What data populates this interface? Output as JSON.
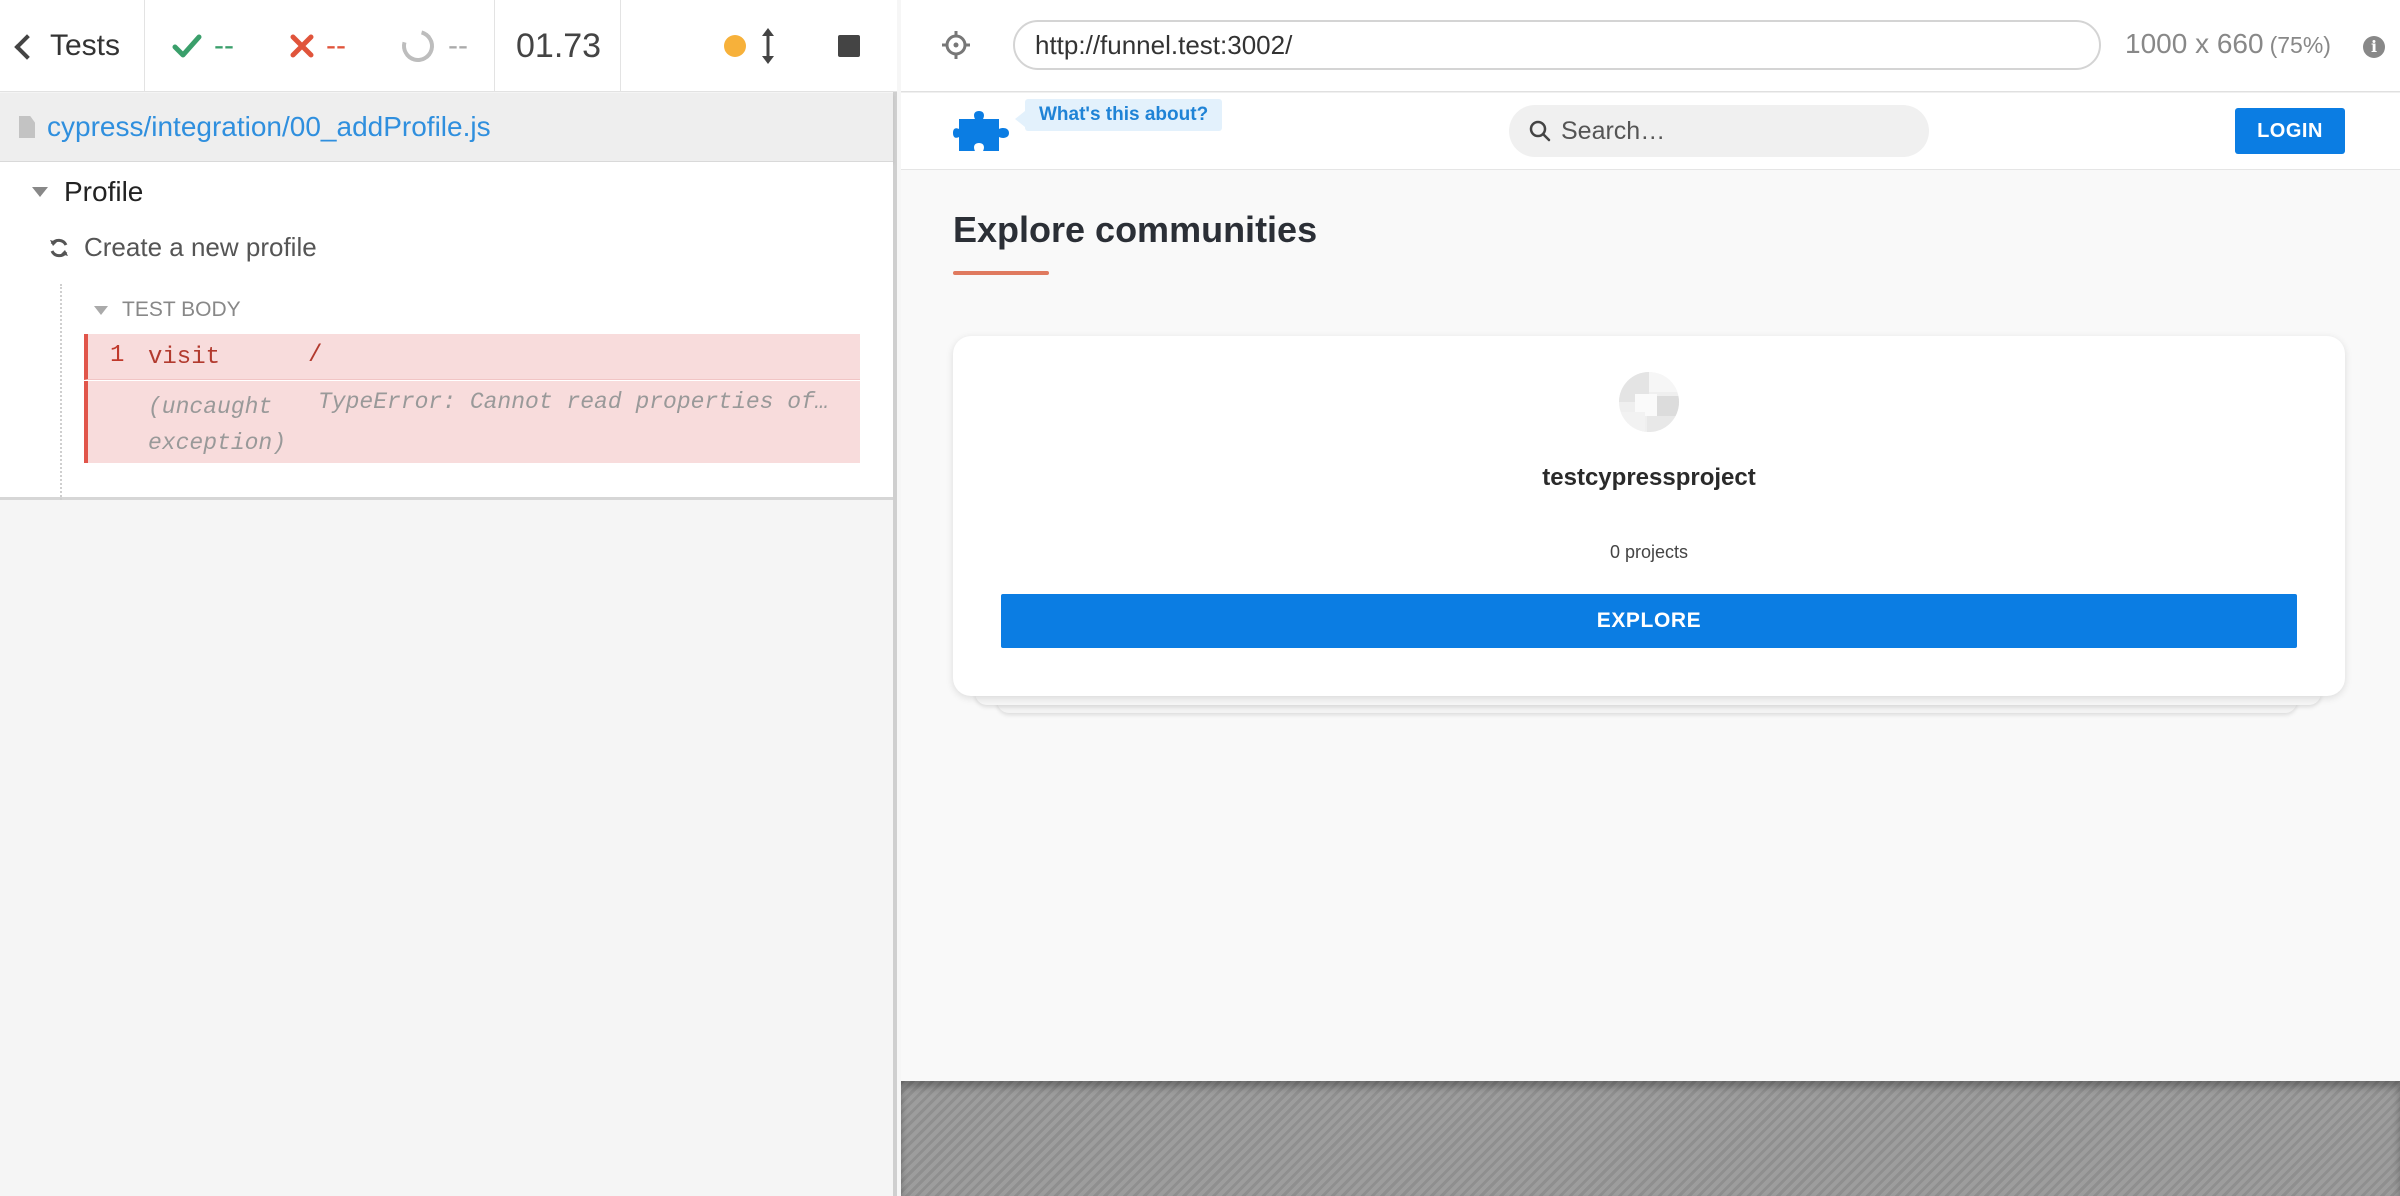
{
  "reporter": {
    "back_label": "Tests",
    "passed": "--",
    "failed": "--",
    "pending": "--",
    "duration": "01.73",
    "spec_path": "cypress/integration/00_addProfile.js",
    "suite_title": "Profile",
    "test_title": "Create a new profile",
    "test_body_label": "TEST BODY",
    "commands": [
      {
        "number": "1",
        "name": "visit",
        "message": "/"
      }
    ],
    "exception": {
      "name": "(uncaught exception)",
      "message": "TypeError: Cannot read properties of…"
    },
    "colors": {
      "pass": "#3a9f6b",
      "fail": "#e0543b",
      "running_dot": "#f7b13a",
      "link": "#2f8fde"
    }
  },
  "aut": {
    "url": "http://funnel.test:3002/",
    "viewport": "1000 x 660",
    "scale": "(75%)"
  },
  "app": {
    "about_tag": "What's this about?",
    "search_placeholder": "Search…",
    "login_label": "LOGIN",
    "page_title": "Explore communities",
    "community": {
      "name": "testcypressproject",
      "project_count": "0 projects",
      "explore_label": "EXPLORE"
    },
    "colors": {
      "primary": "#0b7de3",
      "accent": "#e07a5f"
    }
  },
  "icons": [
    "chevron-left-icon",
    "check-icon",
    "x-icon",
    "pending-ring-icon",
    "running-dot-icon",
    "resize-vertical-icon",
    "stop-icon",
    "file-icon",
    "caret-down-icon",
    "refresh-icon",
    "crosshair-icon",
    "info-icon",
    "puzzle-logo-icon",
    "search-icon"
  ]
}
